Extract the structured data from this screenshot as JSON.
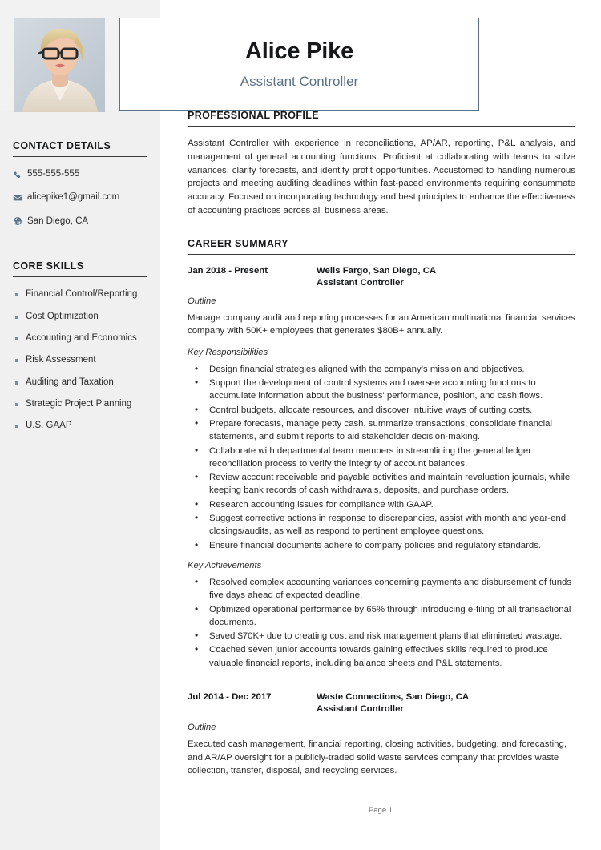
{
  "header": {
    "full_name": "Alice Pike",
    "job_title": "Assistant Controller",
    "photo_alt": "profile-photo"
  },
  "sidebar": {
    "contact": {
      "heading": "CONTACT DETAILS",
      "items": [
        {
          "icon": "phone-icon",
          "value": "555-555-555"
        },
        {
          "icon": "envelope-icon",
          "value": "alicepike1@gmail.com"
        },
        {
          "icon": "globe-icon",
          "value": "San Diego, CA"
        }
      ]
    },
    "skills": {
      "heading": "CORE SKILLS",
      "items": [
        "Financial Control/Reporting",
        "Cost Optimization",
        "Accounting and Economics",
        "Risk Assessment",
        "Auditing and Taxation",
        "Strategic Project Planning",
        "U.S. GAAP"
      ]
    }
  },
  "main": {
    "profile": {
      "heading": "PROFESSIONAL PROFILE",
      "text": "Assistant Controller with experience in reconciliations, AP/AR, reporting, P&L analysis, and management of general accounting functions. Proficient at collaborating with teams to solve variances, clarify forecasts, and identify profit opportunities. Accustomed to handling numerous projects and meeting auditing deadlines within fast-paced environments requiring consummate accuracy. Focused on incorporating technology and best principles to enhance the effectiveness of accounting practices across all business areas."
    },
    "career": {
      "heading": "CAREER SUMMARY",
      "jobs": [
        {
          "dates": "Jan 2018 - Present",
          "company": "Wells Fargo, San Diego, CA",
          "role": "Assistant Controller",
          "outline_label": "Outline",
          "outline": "Manage company audit and reporting processes for an American multinational financial services company with 50K+ employees that generates $80B+ annually.",
          "responsibilities_label": "Key Responsibilities",
          "responsibilities": [
            "Design financial strategies aligned with the company’s mission and objectives.",
            "Support the development of control systems and oversee accounting functions to accumulate information about the business' performance, position, and cash flows.",
            "Control budgets, allocate resources, and discover intuitive ways of cutting costs.",
            "Prepare forecasts, manage petty cash, summarize transactions, consolidate financial statements, and submit reports to aid stakeholder decision-making.",
            "Collaborate with departmental team members in streamlining the general ledger reconciliation process to verify the integrity of account balances.",
            "Review account receivable and payable activities and maintain revaluation journals, while keeping bank records of cash withdrawals, deposits, and purchase orders.",
            "Research accounting issues for compliance with GAAP.",
            "Suggest corrective actions in response to discrepancies, assist with month and year-end closings/audits, as well as respond to pertinent employee questions.",
            "Ensure financial documents adhere to company policies and regulatory standards."
          ],
          "achievements_label": "Key Achievements",
          "achievements": [
            "Resolved complex accounting variances concerning payments and disbursement of funds five days ahead of expected deadline.",
            "Optimized operational performance by 65% through introducing e-filing of all transactional documents.",
            "Saved $70K+ due to creating cost and risk management plans that eliminated wastage.",
            "Coached seven junior accounts towards gaining effectives skills required to produce valuable financial reports, including balance sheets and P&L statements."
          ]
        },
        {
          "dates": "Jul 2014 - Dec 2017",
          "company": "Waste Connections, San Diego, CA",
          "role": "Assistant Controller",
          "outline_label": "Outline",
          "outline": "Executed cash management, financial reporting, closing activities, budgeting, and forecasting, and AR/AP oversight for a publicly-traded solid waste services company that provides waste collection, transfer, disposal, and recycling services."
        }
      ]
    }
  },
  "footer": {
    "page_label": "Page 1"
  },
  "colors": {
    "accent": "#5a7186",
    "sidebar_bg": "#f0f0f0",
    "rule": "#3b3b3b",
    "bullet": "#7d8d9c"
  }
}
